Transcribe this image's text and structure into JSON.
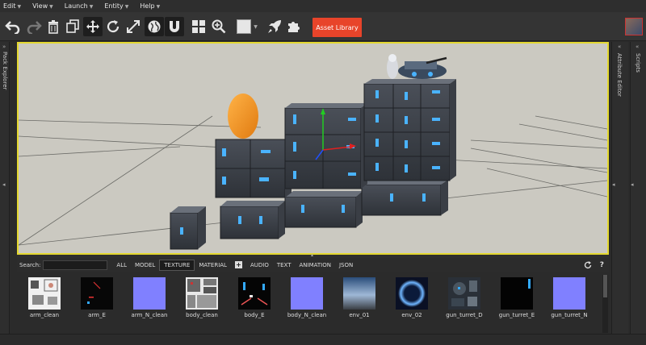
{
  "menu": [
    "Edit",
    "View",
    "Launch",
    "Entity",
    "Help"
  ],
  "toolbar": {
    "asset_library_label": "Asset Library"
  },
  "panels": {
    "left": "Pack Explorer",
    "right_inner": "Attribute Editor",
    "right_outer": "Scripts"
  },
  "search": {
    "label": "Search:",
    "value": ""
  },
  "filter_tabs": [
    "ALL",
    "MODEL",
    "TEXTURE",
    "MATERIAL",
    "AUDIO",
    "TEXT",
    "ANIMATION",
    "JSON"
  ],
  "active_filter": "TEXTURE",
  "assets": [
    "arm_clean",
    "arm_E",
    "arm_N_clean",
    "body_clean",
    "body_E",
    "body_N_clean",
    "env_01",
    "env_02",
    "gun_turret_D",
    "gun_turret_E",
    "gun_turret_N"
  ],
  "colors": {
    "accent": "#e8442a",
    "viewport_border": "#e4d830",
    "normal_map": "#8080ff"
  },
  "icons": [
    "undo-icon",
    "redo-icon",
    "trash-icon",
    "duplicate-icon",
    "move-icon",
    "rotate-icon",
    "scale-icon",
    "world-icon",
    "snap-icon",
    "grid-icon",
    "zoom-icon",
    "color-swatch-icon",
    "launch-icon",
    "puzzle-icon",
    "refresh-icon",
    "help-icon"
  ]
}
